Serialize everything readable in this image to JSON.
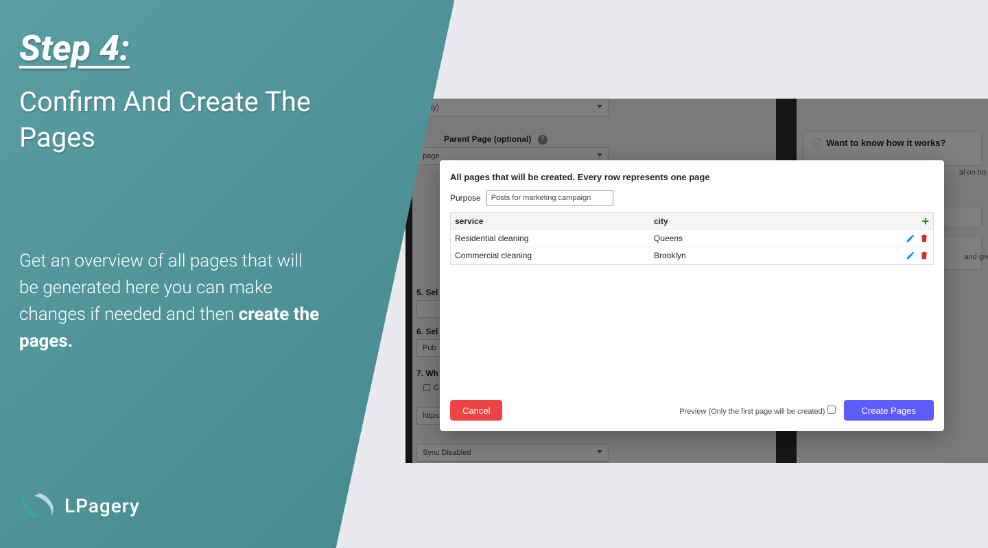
{
  "left": {
    "step": "Step 4:",
    "subtitle": "Confirm And Create The Pages",
    "desc_prefix": "Get an overview of all pages that will be generated here you can make changes if needed and then ",
    "desc_bold": "create the pages."
  },
  "logo": {
    "text": "LPagery"
  },
  "bg": {
    "top_select_label": "(city)",
    "parent_label": "Parent Page (optional)",
    "parent_value": "page",
    "step5": "5. Sel",
    "step6": "6. Sel",
    "step6_value": "Pub",
    "step7": "7. Wh",
    "step7_radio": "CS",
    "url_prefix": "https",
    "sync_value": "Sync Disabled",
    "right_card_title": "Want to know how it works?",
    "right_snip1": "al on ho",
    "right_snip2": "and give"
  },
  "modal": {
    "title": "All pages that will be created. Every row represents one page",
    "purpose_label": "Purpose",
    "purpose_value": "Posts for marketing campaign",
    "columns": {
      "service": "service",
      "city": "city"
    },
    "rows": [
      {
        "service": "Residential cleaning",
        "city": "Queens"
      },
      {
        "service": "Commercial cleaning",
        "city": "Brooklyn"
      }
    ],
    "preview_label": "Preview (Only the first page will be created)",
    "cancel": "Cancel",
    "create": "Create Pages"
  }
}
